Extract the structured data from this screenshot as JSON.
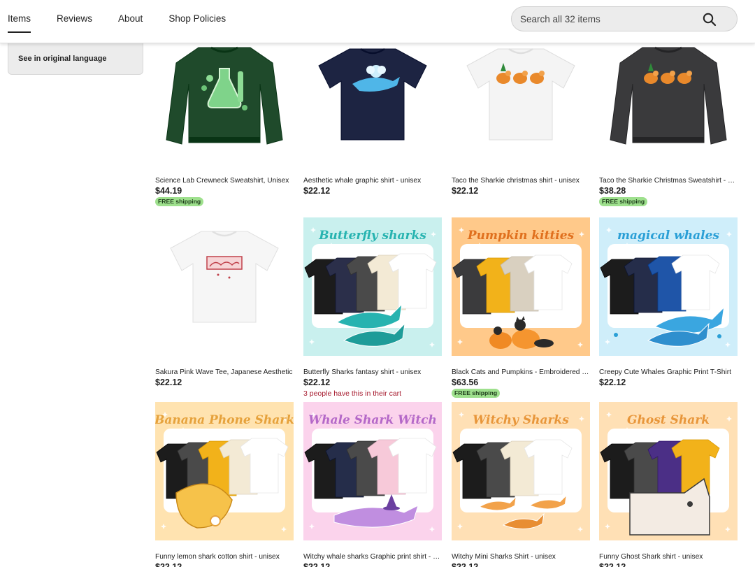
{
  "nav": {
    "tabs": [
      {
        "label": "Items",
        "active": true
      },
      {
        "label": "Reviews"
      },
      {
        "label": "About"
      },
      {
        "label": "Shop Policies"
      }
    ],
    "search": {
      "placeholder": "Search all 32 items",
      "icon": "search-icon"
    }
  },
  "sidebar": {
    "link": "See in original language"
  },
  "products": [
    {
      "title": "Science Lab Crewneck Sweatshirt, Unisex",
      "price": "$44.19",
      "badge": "FREE shipping",
      "image": {
        "kind": "sweater",
        "color": "#1f4a2b",
        "print": "flask"
      }
    },
    {
      "title": "Aesthetic whale graphic shirt - unisex",
      "price": "$22.12",
      "image": {
        "kind": "tee",
        "color": "#1d2442",
        "print": "whale"
      }
    },
    {
      "title": "Taco the Sharkie christmas shirt - unisex",
      "price": "$22.12",
      "image": {
        "kind": "tee",
        "color": "#f4f4f4",
        "print": "dogs"
      }
    },
    {
      "title": "Taco the Sharkie Christmas Sweatshirt - Unisex",
      "price": "$38.28",
      "badge": "FREE shipping",
      "image": {
        "kind": "sweater",
        "color": "#3a3a3c",
        "print": "dogs"
      }
    },
    {
      "title": "Sakura Pink Wave Tee, Japanese Aesthetic",
      "price": "$22.12",
      "image": {
        "kind": "tee",
        "color": "#f6f6f6",
        "print": "sakura"
      }
    },
    {
      "title": "Butterfly Sharks fantasy shirt - unisex",
      "price": "$22.12",
      "note": "3 people have this in their cart",
      "image": {
        "kind": "banner",
        "heading": "Butterfly sharks",
        "bg": "#c9f0ee",
        "accent": "#27b3b0",
        "motif": "teal-sharks",
        "url": "https://www.etsy.com/shop/lemonsrfle",
        "shirts": [
          "#1c1c1c",
          "#2b2f4a",
          "#4a4a4a",
          "#f3ead5",
          "#ffffff"
        ]
      }
    },
    {
      "title": "Black Cats and Pumpkins - Embroidered Sweatshirt",
      "price": "$63.56",
      "badge": "FREE shipping",
      "image": {
        "kind": "banner",
        "heading": "Pumpkin kitties",
        "bg": "#ffc98a",
        "accent": "#e0701e",
        "motif": "cats-pumpkins",
        "url": "https://www.etsy.com/shop/lemonsrfle",
        "shirts": [
          "#3b3b3d",
          "#f2b21a",
          "#d9d0c0",
          "#ffffff"
        ]
      }
    },
    {
      "title": "Creepy Cute Whales Graphic Print T-Shirt",
      "price": "$22.12",
      "image": {
        "kind": "banner",
        "heading": "magical whales",
        "bg": "#cfeefa",
        "accent": "#2a9fd6",
        "motif": "blue-whales",
        "url": "https://www.etsy.com/shop/lemonsrfle",
        "shirts": [
          "#1c1c1c",
          "#252d4a",
          "#1f55a8",
          "#ffffff"
        ]
      }
    },
    {
      "title": "Funny lemon shark cotton shirt - unisex",
      "price": "$22.12",
      "image": {
        "kind": "banner",
        "heading": "Banana Phone Shark",
        "bg": "#ffe3b0",
        "accent": "#e6a23c",
        "motif": "lemon-shark",
        "url": "https://www.etsy.com/shop/lemonsrfle",
        "shirts": [
          "#1c1c1c",
          "#4a4a4a",
          "#f2b21a",
          "#f3ead5",
          "#ffffff"
        ]
      }
    },
    {
      "title": "Witchy whale sharks Graphic print shirt - unisex",
      "price": "$22.12",
      "image": {
        "kind": "banner",
        "heading": "Whale Shark Witch",
        "bg": "#fbd3ec",
        "accent": "#b468c8",
        "motif": "purple-whaleshark",
        "url": "https://www.etsy.com/shop/lemonsrfle",
        "shirts": [
          "#1c1c1c",
          "#252d4a",
          "#4a4a4a",
          "#f7c9d9",
          "#ffffff"
        ]
      }
    },
    {
      "title": "Witchy Mini Sharks Shirt - unisex",
      "price": "$22.12",
      "image": {
        "kind": "banner",
        "heading": "Witchy Sharks",
        "bg": "#ffe0b5",
        "accent": "#e8963a",
        "motif": "orange-sharks",
        "url": "https://www.etsy.com/shop/lemonsrfle",
        "shirts": [
          "#1c1c1c",
          "#4a4a4a",
          "#f3ead5",
          "#ffffff"
        ]
      }
    },
    {
      "title": "Funny Ghost Shark shirt - unisex",
      "price": "$22.12",
      "image": {
        "kind": "banner",
        "heading": "Ghost Shark",
        "bg": "#ffe0b5",
        "accent": "#e8963a",
        "motif": "ghost-shark",
        "url": "https://www.etsy.com/shop/lemonsrfle",
        "shirts": [
          "#1c1c1c",
          "#4a4a4a",
          "#4b2f86",
          "#f2b21a"
        ]
      }
    }
  ]
}
